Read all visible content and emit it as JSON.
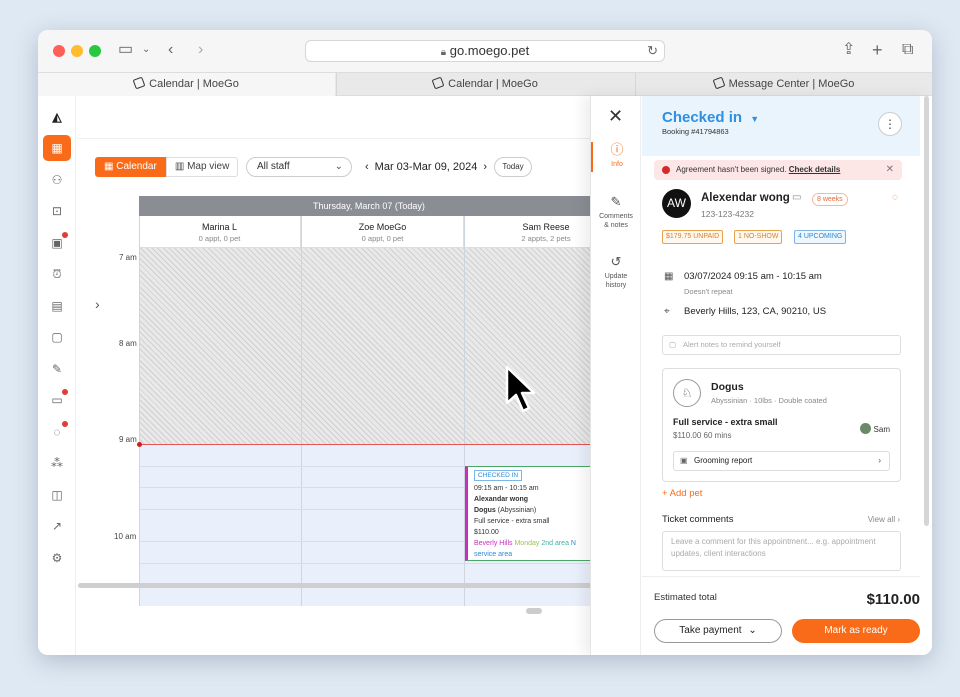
{
  "browser": {
    "url": "go.moego.pet",
    "tabs": [
      {
        "label": "Calendar | MoeGo"
      },
      {
        "label": "Calendar | MoeGo"
      },
      {
        "label": "Message Center | MoeGo"
      }
    ]
  },
  "toolbar": {
    "calendar_label": "Calendar",
    "mapview_label": "Map view",
    "staff_select": "All staff",
    "date_range": "Mar 03-Mar 09, 2024",
    "today_label": "Today"
  },
  "calendar": {
    "day_header": "Thursday, March 07 (Today)",
    "columns": [
      {
        "name": "Marina L",
        "count": "0 appt, 0 pet"
      },
      {
        "name": "Zoe MoeGo",
        "count": "0 appt, 0 pet"
      },
      {
        "name": "Sam Reese",
        "count": "2 appts, 2 pets"
      }
    ],
    "times": [
      "7 am",
      "8 am",
      "9 am",
      "10 am"
    ],
    "appointment": {
      "status": "CHECKED IN",
      "time": "09:15 am - 10:15 am",
      "client": "Alexandar wong",
      "pet": "Dogus",
      "breed": "(Abyssinian)",
      "service": "Full service - extra small",
      "price": "$110.00",
      "tag_area": "Beverly Hills",
      "tag_day": "Monday",
      "tag_area2": "2nd area",
      "tag_more": "N",
      "tag_service_area": "service area"
    }
  },
  "drawer": {
    "tabs": [
      {
        "label": "Info"
      },
      {
        "label": "Comments\n& notes"
      },
      {
        "label": "Update\nhistory"
      }
    ],
    "status": "Checked in",
    "booking": "Booking #41794863",
    "alert_text": "Agreement hasn't been signed.",
    "alert_link": "Check details",
    "client": {
      "initials": "AW",
      "name": "Alexendar wong",
      "phone": "123-123-4232",
      "weeks": "8 weeks"
    },
    "tags": {
      "unpaid": "$179.75 UNPAID",
      "noshow": "1 NO-SHOW",
      "upcoming": "4 UPCOMING"
    },
    "datetime": "03/07/2024 09:15 am - 10:15 am",
    "repeat": "Doesn't repeat",
    "address": "Beverly Hills, 123, CA, 90210, US",
    "notes_placeholder": "Alert notes to remind yourself",
    "pet": {
      "name": "Dogus",
      "info": "Abyssinian · 10lbs · Double coated",
      "service": "Full service - extra small",
      "service_info": "$110.00   60 mins",
      "staff": "Sam",
      "grooming_report": "Grooming report"
    },
    "add_pet": "+ Add pet",
    "ticket_comments": "Ticket comments",
    "view_all": "View all",
    "comment_placeholder": "Leave a comment for this appointment... e.g. appointment updates, client interactions",
    "estimated_label": "Estimated total",
    "estimated_value": "$110.00",
    "take_payment": "Take payment",
    "mark_ready": "Mark as ready"
  },
  "colors": {
    "accent": "#f96b18",
    "status_blue": "#2f8fe0"
  }
}
